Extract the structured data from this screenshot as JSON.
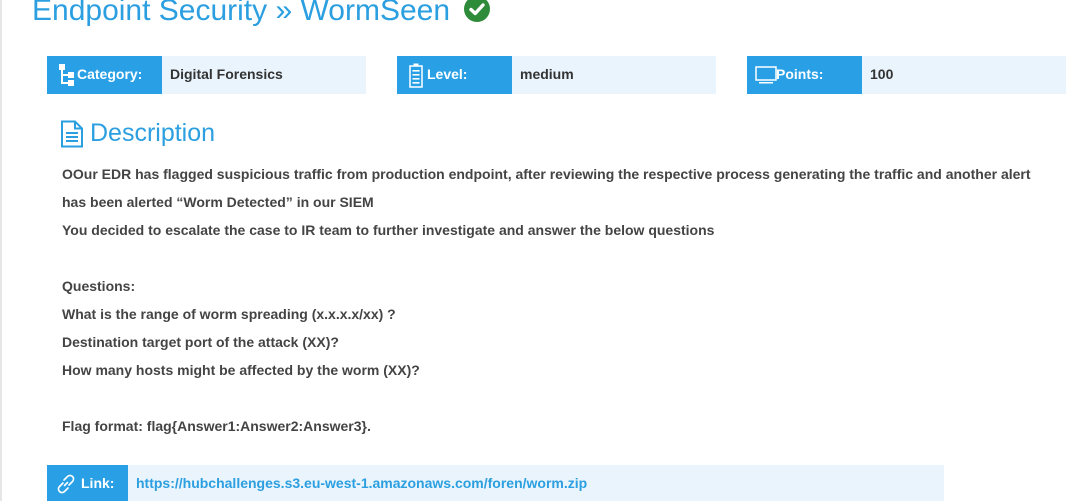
{
  "header": {
    "breadcrumb_category": "Endpoint Security",
    "separator": "»",
    "challenge_name": "WormSeen",
    "solved_icon": "check-circle-icon"
  },
  "info": {
    "category": {
      "label": "Category:",
      "value": "Digital Forensics",
      "icon": "sitemap-icon"
    },
    "level": {
      "label": "Level:",
      "value": "medium",
      "icon": "battery-icon"
    },
    "points": {
      "label": "Points:",
      "value": "100",
      "icon": "monitor-icon"
    }
  },
  "description": {
    "heading": "Description",
    "icon": "document-icon",
    "lines": [
      "OOur EDR has flagged suspicious traffic from production endpoint, after reviewing the respective process generating the traffic and another alert",
      "has been alerted “Worm Detected” in our SIEM",
      "You decided to escalate the case to IR team to further investigate and answer the below questions",
      "",
      "Questions:",
      "What is the range of worm spreading (x.x.x.x/xx) ?",
      "Destination target port of the attack (XX)?",
      "How many hosts might be affected by the worm (XX)?",
      "",
      "Flag format: flag{Answer1:Answer2:Answer3}."
    ]
  },
  "link": {
    "label": "Link:",
    "icon": "link-icon",
    "url": "https://hubchallenges.s3.eu-west-1.amazonaws.com/foren/worm.zip"
  },
  "colors": {
    "accent": "#29a0e6",
    "title": "#2b9fe0",
    "panel_bg": "#e9f4fc",
    "success": "#2e8b3a",
    "body_text": "#444444"
  }
}
